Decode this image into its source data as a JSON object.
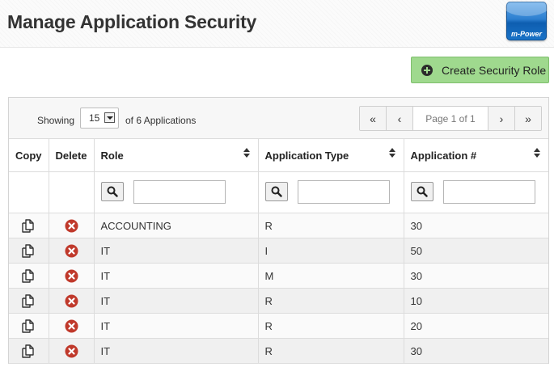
{
  "header": {
    "title": "Manage Application Security",
    "logo_text": "m-Power"
  },
  "toolbar": {
    "create_label": "Create Security Role"
  },
  "list": {
    "showing_label": "Showing",
    "page_size": "15",
    "count_label": "of 6 Applications",
    "pager": {
      "first": "«",
      "prev": "‹",
      "label": "Page 1 of 1",
      "next": "›",
      "last": "»"
    }
  },
  "table": {
    "columns": {
      "copy": "Copy",
      "delete": "Delete",
      "role": "Role",
      "app_type": "Application Type",
      "app_num": "Application #"
    },
    "filters": {
      "role": "",
      "app_type": "",
      "app_num": ""
    },
    "rows": [
      {
        "role": "ACCOUNTING",
        "type": "R",
        "num": "30"
      },
      {
        "role": "IT",
        "type": "I",
        "num": "50"
      },
      {
        "role": "IT",
        "type": "M",
        "num": "30"
      },
      {
        "role": "IT",
        "type": "R",
        "num": "10"
      },
      {
        "role": "IT",
        "type": "R",
        "num": "20"
      },
      {
        "role": "IT",
        "type": "R",
        "num": "30"
      }
    ]
  },
  "colors": {
    "create_button": "#9fd98e",
    "delete_icon": "#c0392b",
    "logo": "#1a73c8"
  },
  "icons": {
    "copy": "copy-icon",
    "delete": "delete-icon",
    "search": "search-icon",
    "sort": "sort-icon",
    "add": "plus-circle-icon"
  }
}
